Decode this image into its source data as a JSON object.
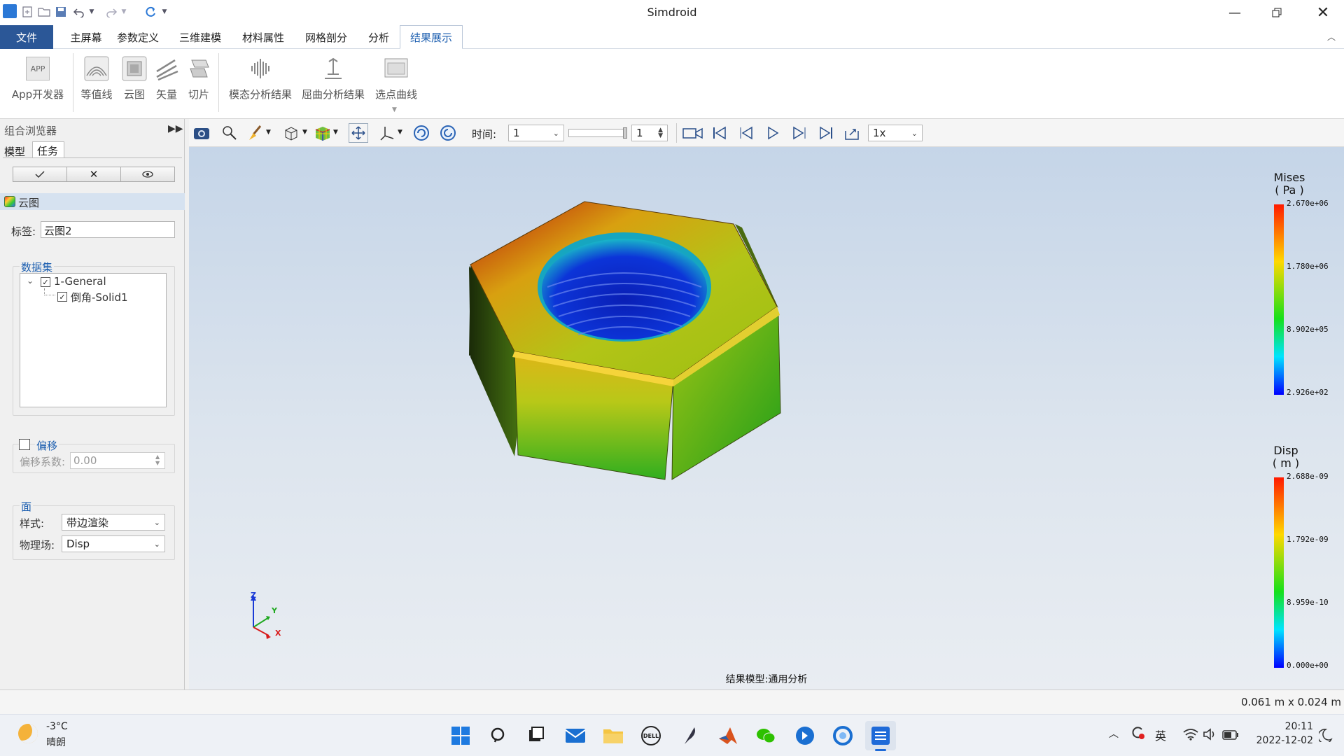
{
  "app": {
    "title": "Simdroid"
  },
  "tabs": {
    "file": "文件",
    "home": "主屏幕",
    "params": "参数定义",
    "model3d": "三维建模",
    "material": "材料属性",
    "mesh": "网格剖分",
    "analysis": "分析",
    "results": "结果展示"
  },
  "ribbon": {
    "app_dev": "App开发器",
    "contour_line": "等值线",
    "cloud": "云图",
    "vector": "矢量",
    "slice": "切片",
    "modal": "模态分析结果",
    "buckling": "屈曲分析结果",
    "pick_curve": "选点曲线",
    "app_icon_text": "APP"
  },
  "toolbar": {
    "time_label": "时间:",
    "time_value": "1",
    "step_value": "1",
    "speed_value": "1x"
  },
  "browser": {
    "title": "组合浏览器",
    "tab_model": "模型",
    "tab_task": "任务",
    "section": "云图",
    "tag_label": "标签:",
    "tag_value": "云图2",
    "dataset_title": "数据集",
    "tree_root": "1-General",
    "tree_child": "倒角-Solid1",
    "offset_title": "偏移",
    "offset_coef_label": "偏移系数:",
    "offset_coef_value": "0.00",
    "face_title": "面",
    "style_label": "样式:",
    "style_value": "带边渲染",
    "field_label": "物理场:",
    "field_value": "Disp"
  },
  "viewport": {
    "caption": "结果模型:通用分析",
    "legend_mises": {
      "title": "Mises",
      "unit": "( Pa )",
      "ticks": [
        "2.670e+06",
        "1.780e+06",
        "8.902e+05",
        "2.926e+02"
      ]
    },
    "legend_disp": {
      "title": "Disp",
      "unit": "( m )",
      "ticks": [
        "2.688e-09",
        "1.792e-09",
        "8.959e-10",
        "0.000e+00"
      ]
    },
    "axes": {
      "z": "Z",
      "y": "Y",
      "x": "X"
    }
  },
  "status": {
    "dims": "0.061 m x 0.024 m"
  },
  "taskbar": {
    "temp": "-3°C",
    "weather": "晴朗",
    "ime": "英",
    "time": "20:11",
    "date": "2022-12-02"
  },
  "colors": {
    "file_tab": "#2b5797",
    "accent": "#1d5fb0"
  }
}
